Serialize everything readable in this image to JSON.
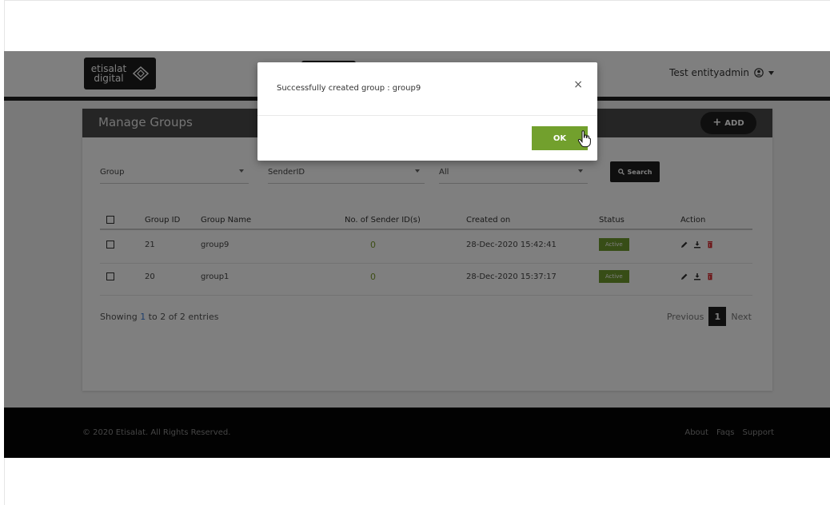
{
  "header": {
    "logo_line1": "etisalat",
    "logo_line2": "digital",
    "user_name": "Test entityadmin"
  },
  "card": {
    "title": "Manage Groups",
    "add_label": "ADD"
  },
  "filters": {
    "group": "Group",
    "sender": "SenderID",
    "status": "All",
    "search_label": "Search"
  },
  "table": {
    "headers": {
      "group_id": "Group ID",
      "group_name": "Group Name",
      "sender_count": "No. of Sender ID(s)",
      "created_on": "Created on",
      "status": "Status",
      "action": "Action"
    },
    "rows": [
      {
        "group_id": "21",
        "group_name": "group9",
        "sender_count": "0",
        "created_on": "28-Dec-2020 15:42:41",
        "status": "Active"
      },
      {
        "group_id": "20",
        "group_name": "group1",
        "sender_count": "0",
        "created_on": "28-Dec-2020 15:37:17",
        "status": "Active"
      }
    ]
  },
  "pagination": {
    "showing_prefix": "Showing ",
    "from": "1",
    "to_label": " to 2 of 2 entries",
    "previous": "Previous",
    "page": "1",
    "next": "Next"
  },
  "footer": {
    "copyright": "© 2020 Etisalat. All Rights Reserved.",
    "links": [
      "About",
      "Faqs",
      "Support"
    ]
  },
  "modal": {
    "message": "Successfully created group : group9",
    "close": "×",
    "ok_label": "OK"
  },
  "colors": {
    "accent_green": "#72a02d",
    "dark": "#1e1e1e"
  }
}
